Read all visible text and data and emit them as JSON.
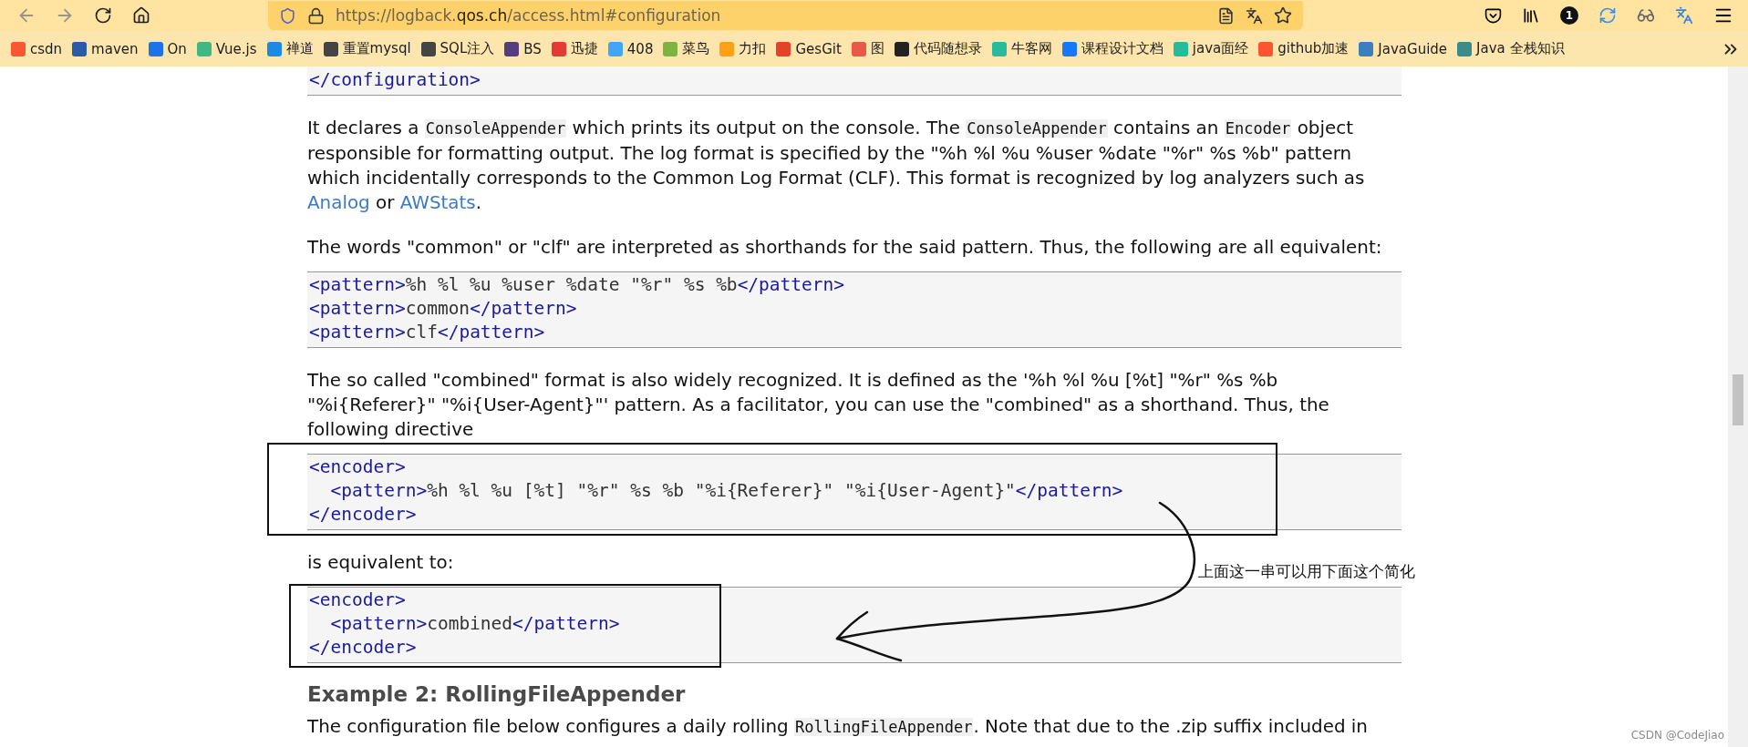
{
  "toolbar": {
    "nav": [
      {
        "kind": "back",
        "disabled": true
      },
      {
        "kind": "forward",
        "disabled": true
      },
      {
        "kind": "reload",
        "disabled": false
      },
      {
        "kind": "home",
        "disabled": false
      }
    ],
    "url": {
      "prefix": "https://logback.",
      "domain": "qos.ch",
      "suffix": "/access.html#configuration"
    },
    "badge": "1"
  },
  "bookmarks": [
    {
      "label": "csdn",
      "color": "#fc5531"
    },
    {
      "label": "maven",
      "color": "#2a5aa8"
    },
    {
      "label": "On",
      "color": "#1a73e8"
    },
    {
      "label": "Vue.js",
      "color": "#41b883"
    },
    {
      "label": "禅道",
      "color": "#1e88e5"
    },
    {
      "label": "重置mysql",
      "color": "#444444"
    },
    {
      "label": "SQL注入",
      "color": "#444444"
    },
    {
      "label": "BS",
      "color": "#563d7c"
    },
    {
      "label": "迅捷",
      "color": "#e53935"
    },
    {
      "label": "408",
      "color": "#42a5f5"
    },
    {
      "label": "菜鸟",
      "color": "#7cb342"
    },
    {
      "label": "力扣",
      "color": "#ffa116"
    },
    {
      "label": "GesGit",
      "color": "#e24329"
    },
    {
      "label": "图",
      "color": "#e8594a"
    },
    {
      "label": "代码随想录",
      "color": "#222222"
    },
    {
      "label": "牛客网",
      "color": "#25bb9b"
    },
    {
      "label": "课程设计文档",
      "color": "#1677ff"
    },
    {
      "label": "java面经",
      "color": "#25bb9b"
    },
    {
      "label": "github加速",
      "color": "#fc5531"
    },
    {
      "label": "JavaGuide",
      "color": "#3c7ebf"
    },
    {
      "label": "Java 全栈知识",
      "color": "#3d8a8a"
    }
  ],
  "content": [
    {
      "kind": "code",
      "lines": [
        "</configuration>"
      ]
    },
    {
      "kind": "paragraph",
      "parts": [
        {
          "kind": "text",
          "text": "It declares a "
        },
        {
          "kind": "code",
          "text": "ConsoleAppender"
        },
        {
          "kind": "text",
          "text": " which prints its output on the console. The "
        },
        {
          "kind": "code",
          "text": "ConsoleAppender"
        },
        {
          "kind": "text",
          "text": " contains an "
        },
        {
          "kind": "code",
          "text": "Encoder"
        },
        {
          "kind": "text",
          "text": " object responsible for formatting output. The log format is specified by the \"%h %l %u %user %date \"%r\" %s %b\" pattern which incidentally corresponds to the Common Log Format (CLF). This format is recognized by log analyzers such as "
        },
        {
          "kind": "link",
          "text": "Analog"
        },
        {
          "kind": "text",
          "text": " or "
        },
        {
          "kind": "link",
          "text": "AWStats"
        },
        {
          "kind": "text",
          "text": "."
        }
      ]
    },
    {
      "kind": "paragraph",
      "parts": [
        {
          "kind": "text",
          "text": "The words \"common\" or \"clf\" are interpreted as shorthands for the said pattern. Thus, the following are all equivalent:"
        }
      ]
    },
    {
      "kind": "code",
      "lines": [
        "<pattern>%h %l %u %user %date \"%r\" %s %b</pattern>",
        "<pattern>common</pattern>",
        "<pattern>clf</pattern>"
      ]
    },
    {
      "kind": "paragraph",
      "parts": [
        {
          "kind": "text",
          "text": "The so called \"combined\" format is also widely recognized. It is defined as the '%h %l %u [%t] \"%r\" %s %b \"%i{Referer}\" \"%i{User-Agent}\"' pattern. As a facilitator, you can use the \"combined\" as a shorthand. Thus, the following directive"
        }
      ]
    },
    {
      "kind": "code",
      "boxed": true,
      "lines": [
        "<encoder>",
        "  <pattern>%h %l %u [%t] \"%r\" %s %b \"%i{Referer}\" \"%i{User-Agent}\"</pattern>",
        "</encoder>"
      ]
    },
    {
      "kind": "paragraph",
      "parts": [
        {
          "kind": "text",
          "text": "is equivalent to:"
        }
      ]
    },
    {
      "kind": "code",
      "boxed": true,
      "lines": [
        "<encoder>",
        "  <pattern>combined</pattern>",
        "</encoder>"
      ]
    },
    {
      "kind": "heading",
      "text": "Example 2: RollingFileAppender"
    },
    {
      "kind": "paragraph",
      "parts": [
        {
          "kind": "text",
          "text": "The configuration file below configures a daily rolling "
        },
        {
          "kind": "code",
          "text": "RollingFileAppender"
        },
        {
          "kind": "text",
          "text": ". Note that due to the .zip suffix included in"
        }
      ]
    }
  ],
  "annotation": {
    "note": "上面这一串可以用下面这个简化"
  },
  "watermark": "CSDN @CodeJiao"
}
